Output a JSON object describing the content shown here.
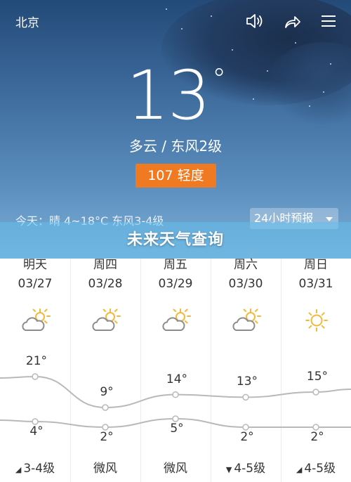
{
  "header": {
    "city": "北京"
  },
  "current": {
    "temperature": "13",
    "degree_symbol": "°",
    "condition": "多云 / 东风2级",
    "aqi": "107 轻度",
    "today_summary": "今天：晴  4~18°C  东风3-4级"
  },
  "forecast_dropdown": {
    "label": "24小时预报"
  },
  "banner": {
    "text": "未来天气查询"
  },
  "colors": {
    "aqi_badge": "#f07a22",
    "curve": "#b9b9b9",
    "sun": "#f5b93a",
    "cloud": "#8c8c8c"
  },
  "days": [
    {
      "name": "明天",
      "date": "03/27",
      "icon": "partly-cloudy-icon",
      "high": "21°",
      "low": "4°",
      "wind": "3-4级",
      "wind_arrow": "◢",
      "high_value": 21,
      "low_value": 4
    },
    {
      "name": "周四",
      "date": "03/28",
      "icon": "partly-cloudy-icon",
      "high": "9°",
      "low": "2°",
      "wind": "微风",
      "wind_arrow": "",
      "high_value": 9,
      "low_value": 2
    },
    {
      "name": "周五",
      "date": "03/29",
      "icon": "partly-cloudy-icon",
      "high": "14°",
      "low": "5°",
      "wind": "微风",
      "wind_arrow": "",
      "high_value": 14,
      "low_value": 5
    },
    {
      "name": "周六",
      "date": "03/30",
      "icon": "partly-cloudy-icon",
      "high": "13°",
      "low": "2°",
      "wind": "4-5级",
      "wind_arrow": "▼",
      "high_value": 13,
      "low_value": 2
    },
    {
      "name": "周日",
      "date": "03/31",
      "icon": "sunny-icon",
      "high": "15°",
      "low": "2°",
      "wind": "4-5级",
      "wind_arrow": "◢",
      "high_value": 15,
      "low_value": 2
    }
  ]
}
